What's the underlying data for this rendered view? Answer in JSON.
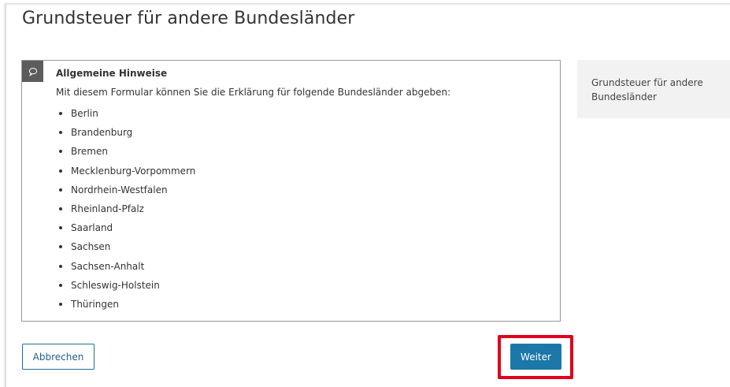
{
  "page": {
    "title": "Grundsteuer für andere Bundesländer"
  },
  "info": {
    "icon": "speech-bubble-icon",
    "heading": "Allgemeine Hinweise",
    "text": "Mit diesem Formular können Sie die Erklärung für folgende Bundesländer abgeben:",
    "states": [
      "Berlin",
      "Brandenburg",
      "Bremen",
      "Mecklenburg-Vorpommern",
      "Nordrhein-Westfalen",
      "Rheinland-Pfalz",
      "Saarland",
      "Sachsen",
      "Sachsen-Anhalt",
      "Schleswig-Holstein",
      "Thüringen"
    ]
  },
  "side_panel": {
    "label": "Grundsteuer für andere Bundesländer"
  },
  "actions": {
    "cancel_label": "Abbrechen",
    "next_label": "Weiter"
  },
  "colors": {
    "primary": "#1b78a8",
    "highlight": "#e0001b",
    "icon_bg": "#5c5c5c",
    "panel_bg": "#f2f2f2"
  }
}
